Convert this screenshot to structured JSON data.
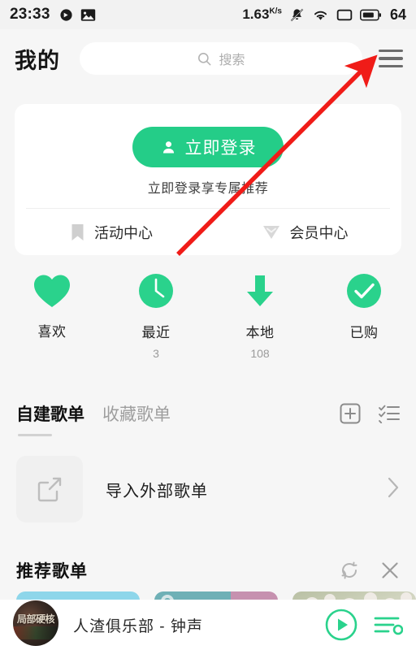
{
  "statusbar": {
    "time": "23:33",
    "left_icons": [
      "compass-icon",
      "image-icon"
    ],
    "net_speed": "1.63",
    "net_speed_unit": "K/s",
    "right_icons": [
      "bell-muted-icon",
      "wifi-icon",
      "screen-icon",
      "battery-icon"
    ],
    "battery_level": "64"
  },
  "header": {
    "title": "我的",
    "search_placeholder": "搜索",
    "search_icon": "search-icon",
    "menu_icon": "hamburger-menu-icon"
  },
  "login_card": {
    "button_label": "立即登录",
    "button_icon": "person-icon",
    "subtitle": "立即登录享专属推荐",
    "links": [
      {
        "label": "活动中心",
        "icon": "bookmark-icon"
      },
      {
        "label": "会员中心",
        "icon": "vip-diamond-icon"
      }
    ]
  },
  "quick_actions": [
    {
      "label": "喜欢",
      "count": "",
      "icon": "heart-icon"
    },
    {
      "label": "最近",
      "count": "3",
      "icon": "clock-icon"
    },
    {
      "label": "本地",
      "count": "108",
      "icon": "download-arrow-icon"
    },
    {
      "label": "已购",
      "count": "",
      "icon": "check-circle-icon"
    }
  ],
  "playlist_tabs": {
    "tabs": [
      {
        "label": "自建歌单",
        "active": true
      },
      {
        "label": "收藏歌单",
        "active": false
      }
    ],
    "add_icon": "plus-box-icon",
    "manage_icon": "checklist-icon"
  },
  "import_row": {
    "label": "导入外部歌单",
    "icon": "import-icon",
    "chevron": "chevron-right-icon"
  },
  "recommend": {
    "title": "推荐歌单",
    "refresh_icon": "refresh-icon",
    "close_icon": "close-icon",
    "cards": [
      {
        "name": "playlist-card-1"
      },
      {
        "name": "playlist-card-2"
      },
      {
        "name": "playlist-card-3"
      }
    ]
  },
  "player": {
    "cover_text": "局部硬核",
    "track": "人渣俱乐部 - 钟声",
    "play_icon": "play-circle-icon",
    "queue_icon": "playlist-queue-icon"
  },
  "annotation": {
    "arrow": "red-arrow-pointing-to-menu",
    "color": "#f01c18"
  },
  "colors": {
    "accent_green": "#24cd88",
    "background": "#f6f6f6",
    "card": "#ffffff",
    "annotation_red": "#f01c18"
  }
}
